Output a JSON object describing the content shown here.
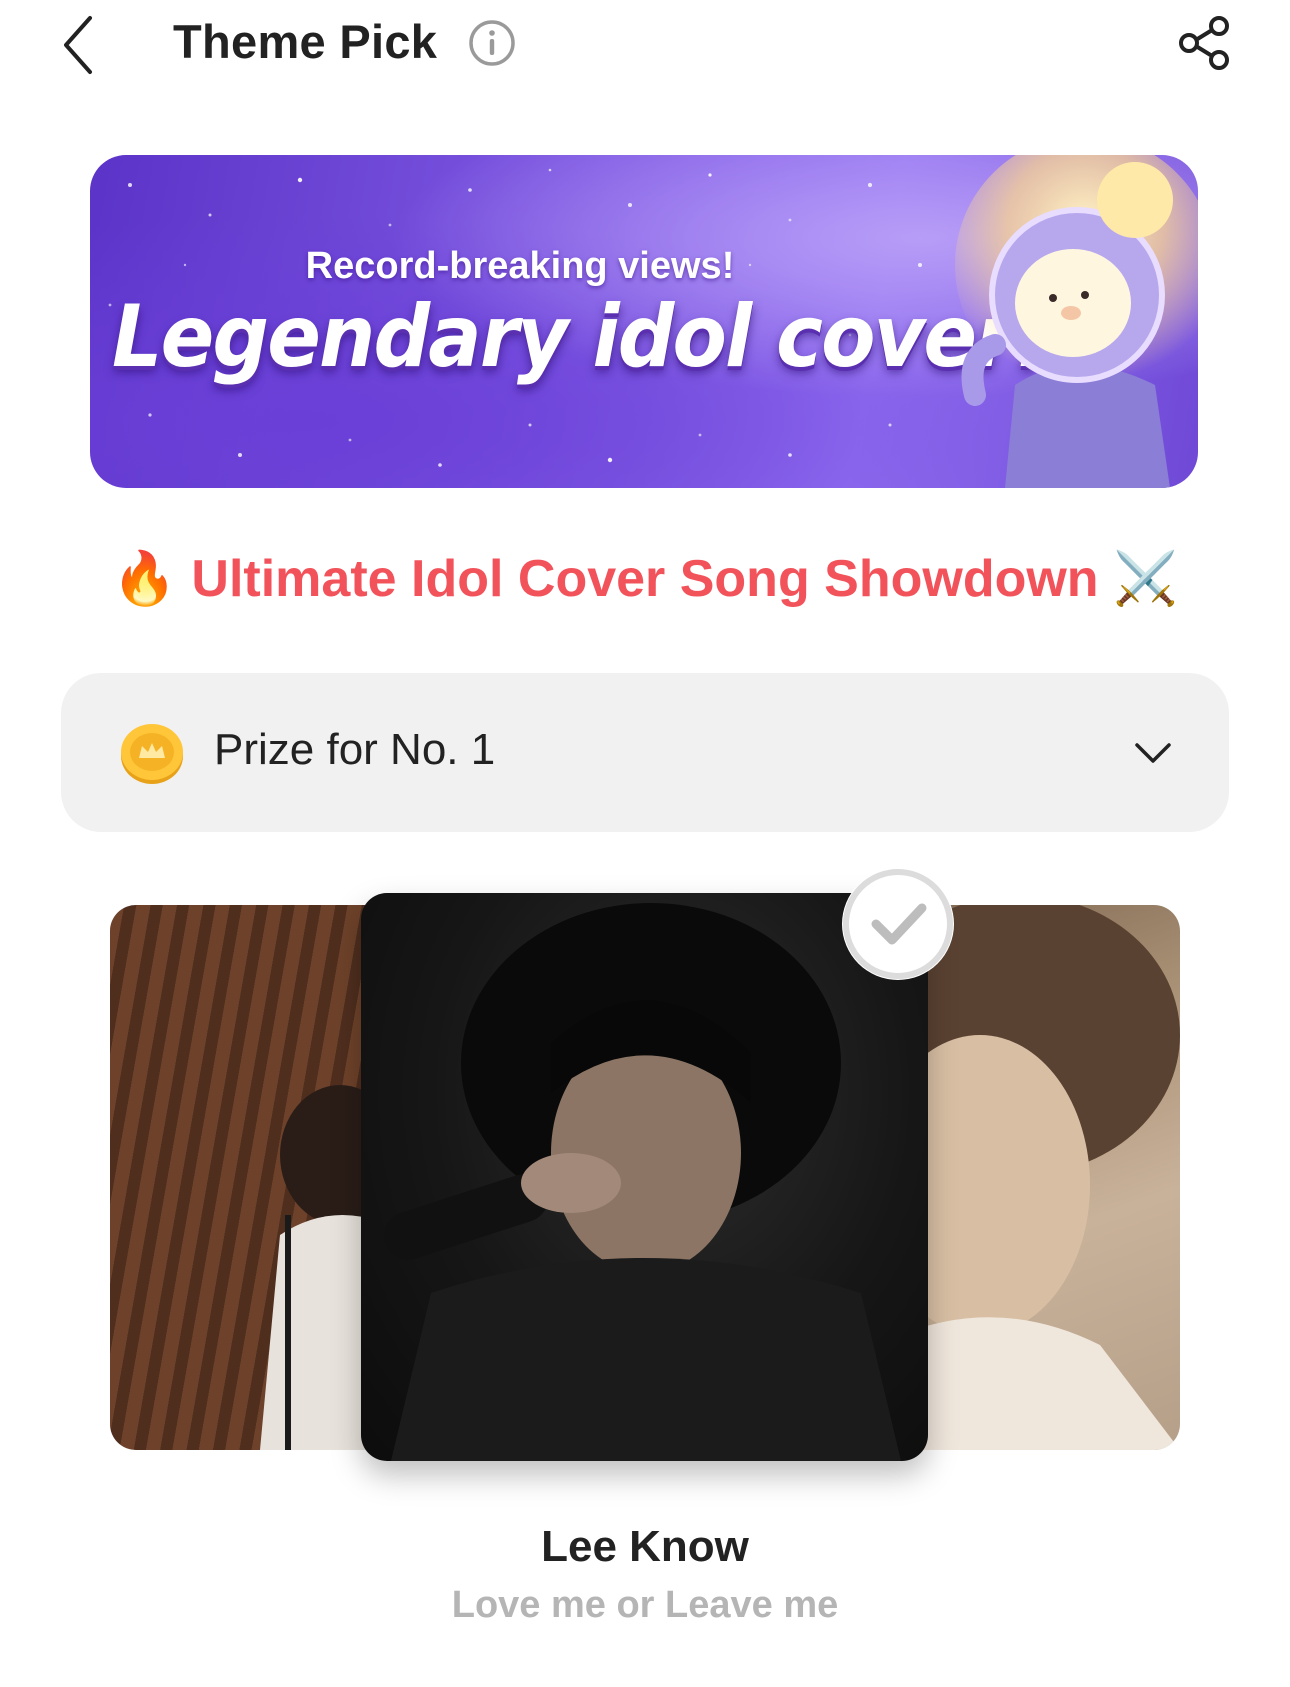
{
  "header": {
    "title": "Theme Pick",
    "back_icon": "chevron-left-icon",
    "info_icon": "info-icon",
    "share_icon": "share-icon"
  },
  "banner": {
    "subtitle": "Record-breaking views!",
    "headline": "Legendary idol cover?",
    "mascot": "astronaut-bear-mascot"
  },
  "theme": {
    "title": "Ultimate Idol Cover Song Showdown",
    "leading_emoji": "🔥",
    "trailing_emoji": "⚔️",
    "color": "#f2535b"
  },
  "prize": {
    "label": "Prize for No. 1",
    "coin_icon": "coin-icon",
    "toggle_icon": "chevron-down-icon"
  },
  "selection": {
    "artist": "Lee Know",
    "song": "Love me or Leave me",
    "selected_icon": "check-circle-icon"
  }
}
